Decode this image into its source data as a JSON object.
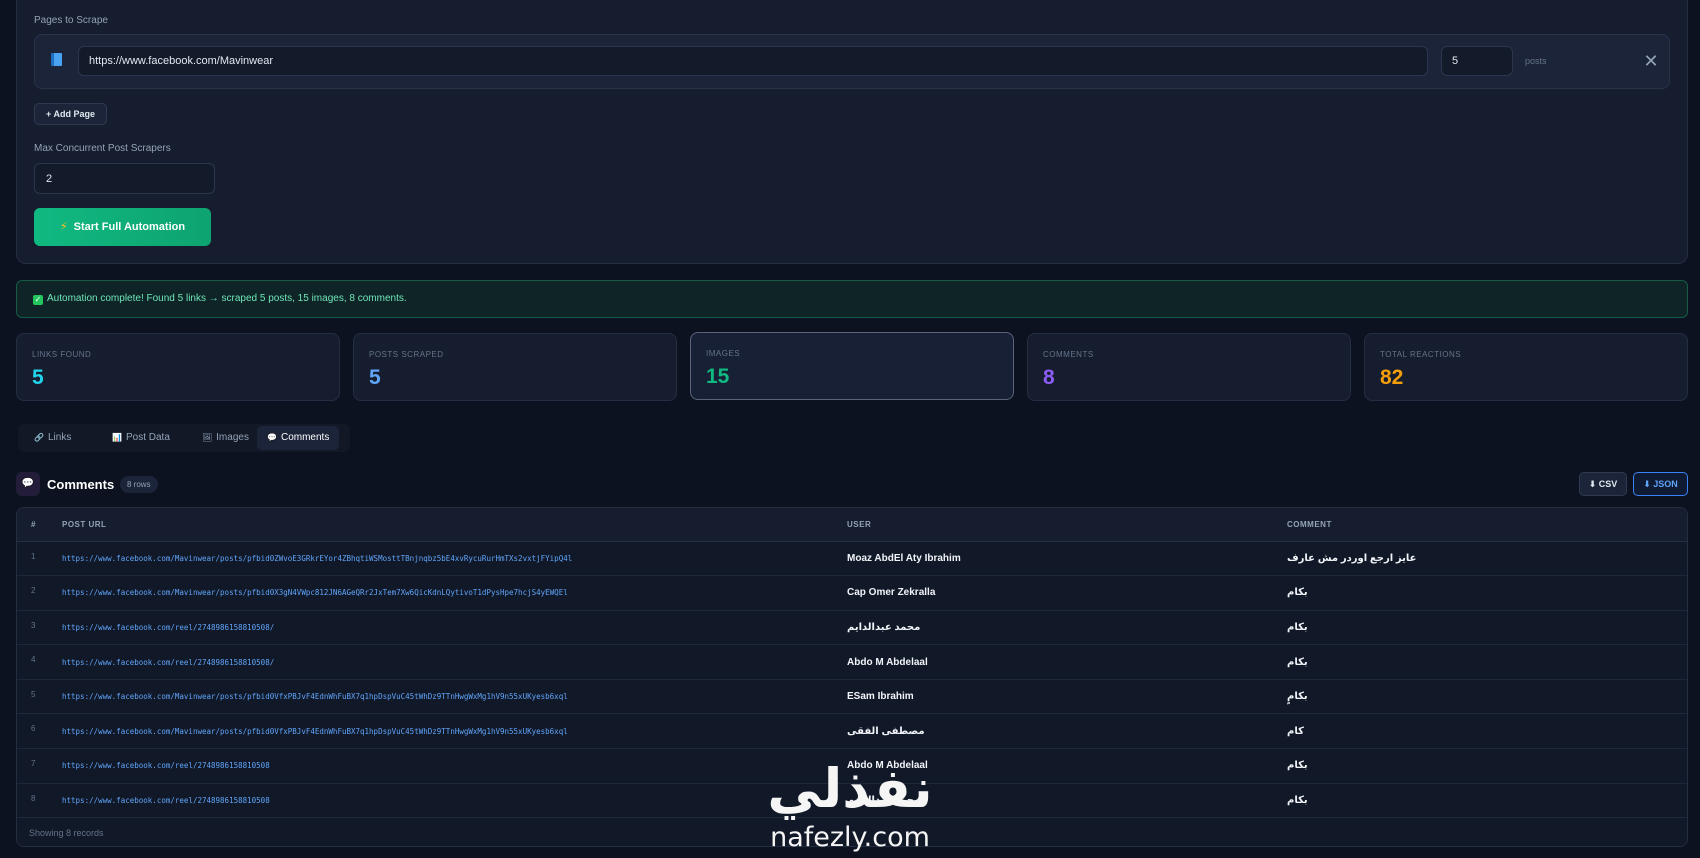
{
  "config": {
    "pages_label": "Pages to Scrape",
    "page_url": "https://www.facebook.com/Mavinwear",
    "posts_count": "5",
    "posts_suffix": "posts",
    "remove_symbol": "✕",
    "add_page_label": "+ Add Page",
    "concurrency_label": "Max Concurrent Post Scrapers",
    "concurrency_value": "2",
    "start_label": "Start Full Automation"
  },
  "alert": {
    "text": "Automation complete! Found 5 links → scraped 5 posts, 15 images, 8 comments.",
    "color": "#6ee7b7"
  },
  "stats": [
    {
      "label": "LINKS FOUND",
      "value": "5",
      "color": "#22d3ee"
    },
    {
      "label": "POSTS SCRAPED",
      "value": "5",
      "color": "#60a5fa"
    },
    {
      "label": "IMAGES",
      "value": "15",
      "color": "#10b981"
    },
    {
      "label": "COMMENTS",
      "value": "8",
      "color": "#8b5cf6"
    },
    {
      "label": "TOTAL REACTIONS",
      "value": "82",
      "color": "#f59e0b"
    }
  ],
  "tabs": [
    {
      "label": "Links",
      "icon": "link-icon",
      "glyph": "🔗"
    },
    {
      "label": "Post Data",
      "icon": "bar-chart-icon",
      "glyph": "📊"
    },
    {
      "label": "Images",
      "icon": "image-icon",
      "glyph": "🖼"
    },
    {
      "label": "Comments",
      "icon": "speech-bubble-icon",
      "glyph": "💬"
    }
  ],
  "active_tab": "Comments",
  "comments": {
    "title": "Comments",
    "rows_badge": "8 rows",
    "csv_label": "⬇ CSV",
    "json_label": "⬇ JSON",
    "columns": [
      "#",
      "POST URL",
      "USER",
      "COMMENT"
    ],
    "rows": [
      {
        "n": "1",
        "url": "https://www.facebook.com/Mavinwear/posts/pfbid0ZWvoE3GRkrEYor4ZBhqtiWSMosttTBnjnqbz5bE4xvRycuRurHmTXs2vxtjFYipQ4l",
        "user": "Moaz AbdEl Aty Ibrahim",
        "comment": "عايز ارجع اوردر مش عارف"
      },
      {
        "n": "2",
        "url": "https://www.facebook.com/Mavinwear/posts/pfbid0X3gN4VWpc812JN6AGeQRr2JxTem7Xw6QicKdnLQytivoT1dPysHpe7hcjS4yEWQEl",
        "user": "Cap Omer Zekralla",
        "comment": "بكام"
      },
      {
        "n": "3",
        "url": "https://www.facebook.com/reel/2748986158810508/",
        "user": "محمد عبدالدايم",
        "comment": "بكام"
      },
      {
        "n": "4",
        "url": "https://www.facebook.com/reel/2748986158810508/",
        "user": "Abdo M Abdelaal",
        "comment": "بكام"
      },
      {
        "n": "5",
        "url": "https://www.facebook.com/Mavinwear/posts/pfbid0VfxPBJvF4EdnWhFuBX7q1hpDspVuC45tWhDz9TTnHwgWxMg1hV9n55xUKyesb6xql",
        "user": "ESam Ibrahim",
        "comment": "بكامٍ"
      },
      {
        "n": "6",
        "url": "https://www.facebook.com/Mavinwear/posts/pfbid0VfxPBJvF4EdnWhFuBX7q1hpDspVuC45tWhDz9TTnHwgWxMg1hV9n55xUKyesb6xql",
        "user": "مصطفى الفقى",
        "comment": "كام"
      },
      {
        "n": "7",
        "url": "https://www.facebook.com/reel/2748986158810508",
        "user": "Abdo M Abdelaal",
        "comment": "بكام"
      },
      {
        "n": "8",
        "url": "https://www.facebook.com/reel/2748986158810508",
        "user": "محمد عبدالدايم",
        "comment": "بكام"
      }
    ],
    "footer": "Showing 8 records"
  },
  "watermark": {
    "arabic": "نفذلي",
    "latin": "nafezly.com"
  }
}
